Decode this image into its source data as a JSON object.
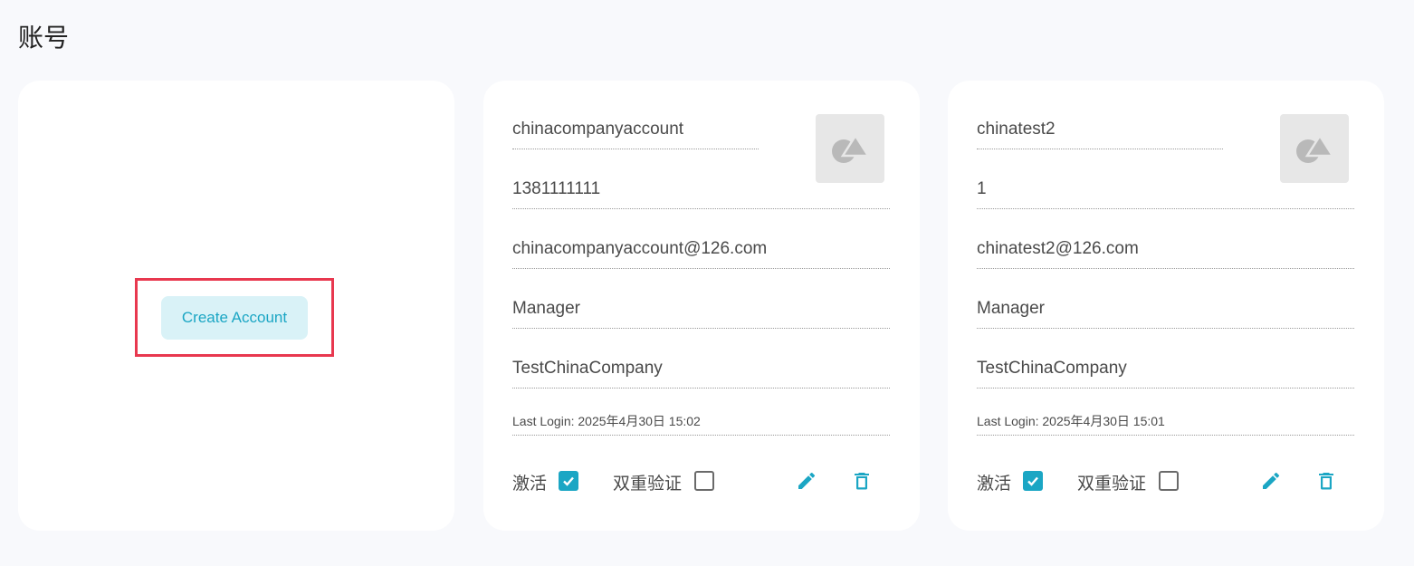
{
  "page": {
    "title": "账号"
  },
  "create_card": {
    "button_label": "Create Account"
  },
  "accounts": [
    {
      "name": "chinacompanyaccount",
      "phone": "1381111111",
      "email": "chinacompanyaccount@126.com",
      "role": "Manager",
      "company": "TestChinaCompany",
      "last_login": "Last Login: 2025年4月30日 15:02",
      "active_label": "激活",
      "active_checked": true,
      "two_factor_label": "双重验证",
      "two_factor_checked": false,
      "avatar_icon": "shapes-icon",
      "edit_icon": "pencil-icon",
      "delete_icon": "trash-icon"
    },
    {
      "name": "chinatest2",
      "phone": "1",
      "email": "chinatest2@126.com",
      "role": "Manager",
      "company": "TestChinaCompany",
      "last_login": "Last Login: 2025年4月30日 15:01",
      "active_label": "激活",
      "active_checked": true,
      "two_factor_label": "双重验证",
      "two_factor_checked": false,
      "avatar_icon": "shapes-icon",
      "edit_icon": "pencil-icon",
      "delete_icon": "trash-icon"
    }
  ],
  "colors": {
    "accent": "#1ba6c4",
    "button_bg": "#d9f2f7",
    "highlight": "#e8384f",
    "page_bg": "#f8f9fc",
    "card_bg": "#ffffff"
  }
}
